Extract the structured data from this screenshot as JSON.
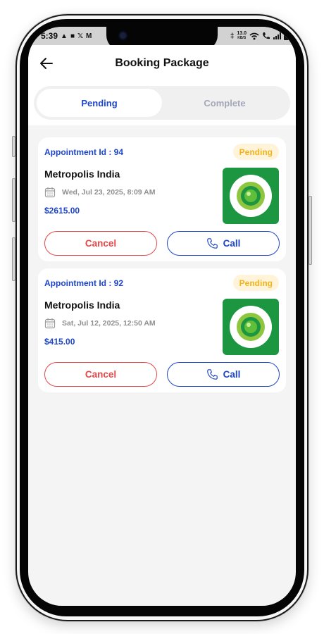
{
  "status_bar": {
    "time": "5:39",
    "network_speed": "13.0",
    "network_unit": "KB/S"
  },
  "header": {
    "title": "Booking Package",
    "back_icon": "arrow-left-icon"
  },
  "tabs": [
    {
      "label": "Pending",
      "active": true
    },
    {
      "label": "Complete",
      "active": false
    }
  ],
  "bookings": [
    {
      "appointment_id": "Appointment Id : 94",
      "status": "Pending",
      "provider": "Metropolis India",
      "datetime": "Wed, Jul 23, 2025, 8:09 AM",
      "price": "$2615.00",
      "cancel_label": "Cancel",
      "call_label": "Call"
    },
    {
      "appointment_id": "Appointment Id : 92",
      "status": "Pending",
      "provider": "Metropolis India",
      "datetime": "Sat, Jul 12, 2025, 12:50 AM",
      "price": "$415.00",
      "cancel_label": "Cancel",
      "call_label": "Call"
    }
  ],
  "colors": {
    "accent_blue": "#1e45c8",
    "cancel_red": "#e44848",
    "pending_badge_text": "#f1b31c",
    "pending_badge_bg": "#fff4d9",
    "logo_green": "#1c9640",
    "background": "#f4f4f4"
  },
  "icons": {
    "calendar": "calendar-icon",
    "phone": "phone-icon",
    "logo": "metropolis-logo-icon"
  }
}
